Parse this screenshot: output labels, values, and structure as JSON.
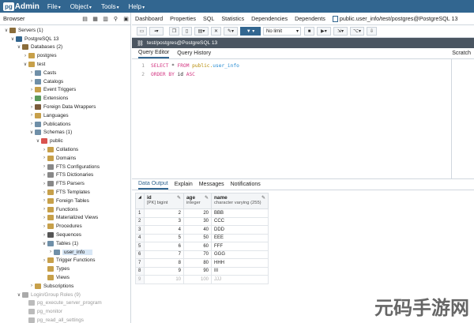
{
  "app": {
    "logo_pg": "pg",
    "logo_admin": "Admin"
  },
  "menu": [
    "File",
    "Object",
    "Tools",
    "Help"
  ],
  "browser": {
    "title": "Browser",
    "tree": [
      {
        "level": 0,
        "toggle": "∨",
        "label": "Servers (1)",
        "color": "#8a6d3b",
        "dim": false
      },
      {
        "level": 1,
        "toggle": "∨",
        "label": "PostgreSQL 13",
        "color": "#326690",
        "dim": false
      },
      {
        "level": 2,
        "toggle": "∨",
        "label": "Databases (2)",
        "color": "#8a6d3b",
        "dim": false
      },
      {
        "level": 3,
        "toggle": "›",
        "label": "postgres",
        "color": "#c7a04a",
        "dim": false
      },
      {
        "level": 3,
        "toggle": "∨",
        "label": "test",
        "color": "#c7a04a",
        "dim": false
      },
      {
        "level": 4,
        "toggle": "›",
        "label": "Casts",
        "color": "#6f8fa8",
        "dim": false
      },
      {
        "level": 4,
        "toggle": "›",
        "label": "Catalogs",
        "color": "#6f8fa8",
        "dim": false
      },
      {
        "level": 4,
        "toggle": "›",
        "label": "Event Triggers",
        "color": "#c7a04a",
        "dim": false
      },
      {
        "level": 4,
        "toggle": "›",
        "label": "Extensions",
        "color": "#5b9a5b",
        "dim": false
      },
      {
        "level": 4,
        "toggle": "›",
        "label": "Foreign Data Wrappers",
        "color": "#7a5b3b",
        "dim": false
      },
      {
        "level": 4,
        "toggle": "›",
        "label": "Languages",
        "color": "#c7a04a",
        "dim": false
      },
      {
        "level": 4,
        "toggle": "›",
        "label": "Publications",
        "color": "#6f8fa8",
        "dim": false
      },
      {
        "level": 4,
        "toggle": "∨",
        "label": "Schemas (1)",
        "color": "#6f8fa8",
        "dim": false
      },
      {
        "level": 5,
        "toggle": "∨",
        "label": "public",
        "color": "#d9534f",
        "dim": false
      },
      {
        "level": 6,
        "toggle": "›",
        "label": "Collations",
        "color": "#c7a04a",
        "dim": false
      },
      {
        "level": 6,
        "toggle": "›",
        "label": "Domains",
        "color": "#c7a04a",
        "dim": false
      },
      {
        "level": 6,
        "toggle": "›",
        "label": "FTS Configurations",
        "color": "#888",
        "dim": false
      },
      {
        "level": 6,
        "toggle": "›",
        "label": "FTS Dictionaries",
        "color": "#888",
        "dim": false
      },
      {
        "level": 6,
        "toggle": "›",
        "label": "FTS Parsers",
        "color": "#888",
        "dim": false
      },
      {
        "level": 6,
        "toggle": "›",
        "label": "FTS Templates",
        "color": "#c7a04a",
        "dim": false
      },
      {
        "level": 6,
        "toggle": "›",
        "label": "Foreign Tables",
        "color": "#c7a04a",
        "dim": false
      },
      {
        "level": 6,
        "toggle": "›",
        "label": "Functions",
        "color": "#c7a04a",
        "dim": false
      },
      {
        "level": 6,
        "toggle": "›",
        "label": "Materialized Views",
        "color": "#c7a04a",
        "dim": false
      },
      {
        "level": 6,
        "toggle": "›",
        "label": "Procedures",
        "color": "#c7a04a",
        "dim": false
      },
      {
        "level": 6,
        "toggle": "›",
        "label": "Sequences",
        "color": "#555",
        "dim": false
      },
      {
        "level": 6,
        "toggle": "∨",
        "label": "Tables (1)",
        "color": "#6f8fa8",
        "dim": false
      },
      {
        "level": 7,
        "toggle": "›",
        "label": "user_info",
        "color": "#6f8fa8",
        "dim": false,
        "selected": true
      },
      {
        "level": 6,
        "toggle": "›",
        "label": "Trigger Functions",
        "color": "#c7a04a",
        "dim": false
      },
      {
        "level": 6,
        "toggle": "",
        "label": "Types",
        "color": "#c7a04a",
        "dim": false
      },
      {
        "level": 6,
        "toggle": "",
        "label": "Views",
        "color": "#c7a04a",
        "dim": false
      },
      {
        "level": 4,
        "toggle": "›",
        "label": "Subscriptions",
        "color": "#c7a04a",
        "dim": false
      },
      {
        "level": 2,
        "toggle": "∨",
        "label": "Login/Group Roles (9)",
        "color": "#aaa",
        "dim": true
      },
      {
        "level": 3,
        "toggle": "",
        "label": "pg_execute_server_program",
        "color": "#bbb",
        "dim": true
      },
      {
        "level": 3,
        "toggle": "",
        "label": "pg_monitor",
        "color": "#bbb",
        "dim": true
      },
      {
        "level": 3,
        "toggle": "",
        "label": "pg_read_all_settings",
        "color": "#bbb",
        "dim": true
      }
    ]
  },
  "top_tabs": [
    "Dashboard",
    "Properties",
    "SQL",
    "Statistics",
    "Dependencies",
    "Dependents"
  ],
  "active_tab": "public.user_info/test/postgres@PostgreSQL 13",
  "toolbar": {
    "limit_value": "No limit"
  },
  "connection": "test/postgres@PostgreSQL 13",
  "editor_tabs": [
    "Query Editor",
    "Query History"
  ],
  "scratch_label": "Scratch",
  "sql": {
    "line1": {
      "n": "1",
      "select": "SELECT",
      "star": " * ",
      "from": "FROM",
      "schema": " public.",
      "table": "user_info"
    },
    "line2": {
      "n": "2",
      "order": "ORDER BY",
      "col": " id ",
      "asc": "ASC"
    }
  },
  "output_tabs": [
    "Data Output",
    "Explain",
    "Messages",
    "Notifications"
  ],
  "columns": [
    {
      "name": "id",
      "type": "[PK] bigint"
    },
    {
      "name": "age",
      "type": "integer"
    },
    {
      "name": "name",
      "type": "character varying (255)"
    }
  ],
  "rows": [
    {
      "n": "1",
      "id": "2",
      "age": "20",
      "name": "BBB"
    },
    {
      "n": "2",
      "id": "3",
      "age": "30",
      "name": "CCC"
    },
    {
      "n": "3",
      "id": "4",
      "age": "40",
      "name": "DDD"
    },
    {
      "n": "4",
      "id": "5",
      "age": "50",
      "name": "EEE"
    },
    {
      "n": "5",
      "id": "6",
      "age": "60",
      "name": "FFF"
    },
    {
      "n": "6",
      "id": "7",
      "age": "70",
      "name": "GGG"
    },
    {
      "n": "7",
      "id": "8",
      "age": "80",
      "name": "HHH"
    },
    {
      "n": "8",
      "id": "9",
      "age": "90",
      "name": "III"
    },
    {
      "n": "9",
      "id": "10",
      "age": "100",
      "name": "JJJ"
    }
  ],
  "watermark": "元码手游网"
}
